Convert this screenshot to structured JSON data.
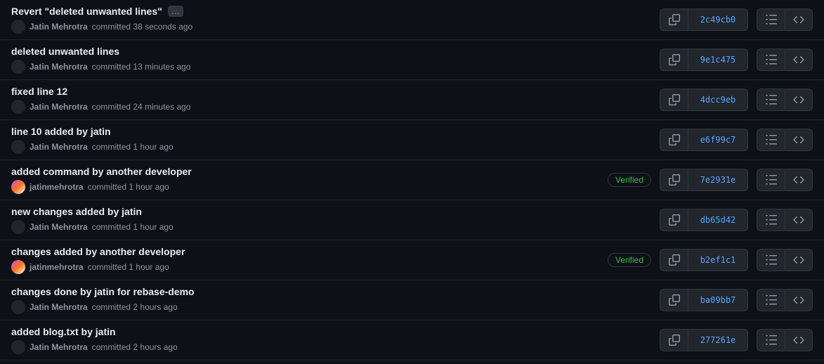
{
  "labels": {
    "committed": "committed",
    "verified": "Verified"
  },
  "commits": [
    {
      "title": "Revert \"deleted unwanted lines\"",
      "has_ellipsis": true,
      "author": "Jatin Mehrotra",
      "has_avatar": false,
      "time": "38 seconds ago",
      "sha": "2c49cb0",
      "verified": false
    },
    {
      "title": "deleted unwanted lines",
      "has_ellipsis": false,
      "author": "Jatin Mehrotra",
      "has_avatar": false,
      "time": "13 minutes ago",
      "sha": "9e1c475",
      "verified": false
    },
    {
      "title": "fixed line 12",
      "has_ellipsis": false,
      "author": "Jatin Mehrotra",
      "has_avatar": false,
      "time": "24 minutes ago",
      "sha": "4dcc9eb",
      "verified": false
    },
    {
      "title": "line 10 added by jatin",
      "has_ellipsis": false,
      "author": "Jatin Mehrotra",
      "has_avatar": false,
      "time": "1 hour ago",
      "sha": "e6f99c7",
      "verified": false
    },
    {
      "title": "added command by another developer",
      "has_ellipsis": false,
      "author": "jatinmehrotra",
      "has_avatar": true,
      "time": "1 hour ago",
      "sha": "7e2931e",
      "verified": true
    },
    {
      "title": "new changes added by jatin",
      "has_ellipsis": false,
      "author": "Jatin Mehrotra",
      "has_avatar": false,
      "time": "1 hour ago",
      "sha": "db65d42",
      "verified": false
    },
    {
      "title": "changes added by another developer",
      "has_ellipsis": false,
      "author": "jatinmehrotra",
      "has_avatar": true,
      "time": "1 hour ago",
      "sha": "b2ef1c1",
      "verified": true
    },
    {
      "title": "changes done by jatin for rebase-demo",
      "has_ellipsis": false,
      "author": "Jatin Mehrotra",
      "has_avatar": false,
      "time": "2 hours ago",
      "sha": "ba09bb7",
      "verified": false
    },
    {
      "title": "added blog.txt by jatin",
      "has_ellipsis": false,
      "author": "Jatin Mehrotra",
      "has_avatar": false,
      "time": "2 hours ago",
      "sha": "277261e",
      "verified": false
    }
  ]
}
